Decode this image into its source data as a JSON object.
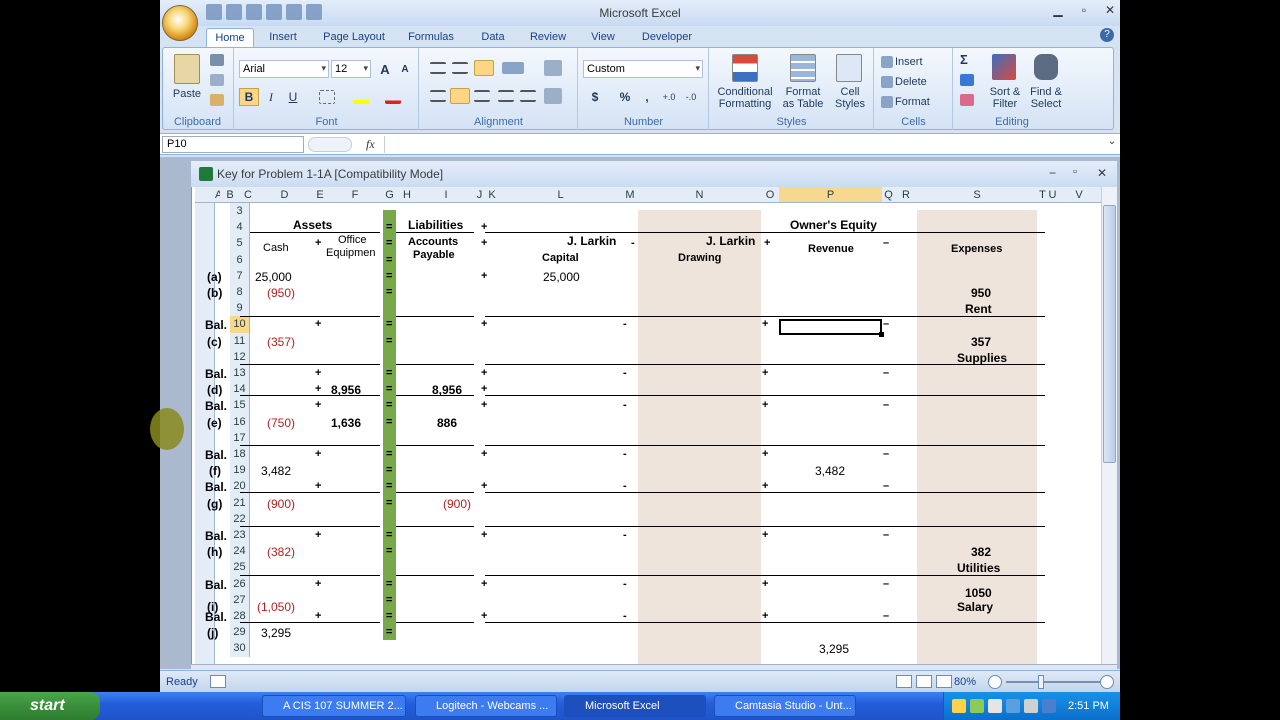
{
  "window": {
    "title": "Microsoft Excel",
    "minimize": "▁",
    "restore": "▫",
    "close": "✕"
  },
  "tabs": [
    "Home",
    "Insert",
    "Page Layout",
    "Formulas",
    "Data",
    "Review",
    "View",
    "Developer"
  ],
  "ribbon": {
    "clipboard": {
      "paste": "Paste",
      "label": "Clipboard"
    },
    "font": {
      "name": "Arial",
      "size": "12",
      "bold": "B",
      "italic": "I",
      "underline": "U",
      "label": "Font",
      "grow": "A",
      "shrink": "A"
    },
    "alignment": {
      "label": "Alignment"
    },
    "number": {
      "format": "Custom",
      "currency": "$",
      "percent": "%",
      "comma": ",",
      "label": "Number",
      "inc_decimal": "+.0",
      "dec_decimal": "-.0"
    },
    "styles": {
      "conditional": "Conditional",
      "conditional2": "Formatting",
      "format_table": "Format",
      "format_table2": "as Table",
      "cell_styles": "Cell",
      "cell_styles2": "Styles",
      "label": "Styles"
    },
    "cells": {
      "insert": "Insert",
      "delete": "Delete",
      "format": "Format",
      "label": "Cells"
    },
    "editing": {
      "sigma": "Σ",
      "sort": "Sort &",
      "sort2": "Filter",
      "find": "Find &",
      "find2": "Select",
      "label": "Editing"
    }
  },
  "formula_bar": {
    "name_box": "P10",
    "fx": "fx",
    "value": ""
  },
  "workbook": {
    "title": "Key for Problem 1-1A  [Compatibility Mode]"
  },
  "columns": [
    "A",
    "B",
    "C",
    "D",
    "E",
    "F",
    "G",
    "H",
    "I",
    "J",
    "K",
    "L",
    "M",
    "N",
    "O",
    "P",
    "Q",
    "R",
    "S",
    "T",
    "U",
    "V"
  ],
  "rows": [
    "3",
    "4",
    "5",
    "6",
    "7",
    "8",
    "9",
    "10",
    "11",
    "12",
    "13",
    "14",
    "15",
    "16",
    "17",
    "18",
    "19",
    "20",
    "21",
    "22",
    "23",
    "24",
    "25",
    "26",
    "27",
    "28",
    "29",
    "30"
  ],
  "sheet": {
    "assets": "Assets",
    "liabilities": "Liabilities",
    "owners_equity": "Owner's Equity",
    "cash": "Cash",
    "office_equipment": "Office",
    "office_equipment2": "Equipmen",
    "accounts_payable": "Accounts",
    "accounts_payable2": "Payable",
    "larkin1": "J. Larkin",
    "capital": "Capital",
    "larkin2": "J. Larkin",
    "drawing": "Drawing",
    "revenue": "Revenue",
    "expenses": "Expenses",
    "plus": "+",
    "minus": "-",
    "endash": "–",
    "equals": "=",
    "r7_label": "(a)",
    "r7_cash": "25,000",
    "r7_capital": "25,000",
    "r8_label": "(b)",
    "r8_cash": "(950)",
    "r8_exp": "950",
    "r9_exp": "Rent",
    "r10_label": "Bal.",
    "r11_label": "(c)",
    "r11_cash": "(357)",
    "r11_exp": "357",
    "r12_exp": "Supplies",
    "r13_label": "Bal.",
    "r14_label": "(d)",
    "r14_equip": "8,956",
    "r14_ap": "8,956",
    "r15_label": "Bal.",
    "r16_label": "(e)",
    "r16_cash": "(750)",
    "r16_equip": "1,636",
    "r16_ap": "886",
    "r18_label": "Bal.",
    "r19_label": "(f)",
    "r19_cash": "3,482",
    "r19_rev": "3,482",
    "r20_label": "Bal.",
    "r21_label": "(g)",
    "r21_cash": "(900)",
    "r21_ap": "(900)",
    "r23_label": "Bal.",
    "r24_label": "(h)",
    "r24_cash": "(382)",
    "r24_exp": "382",
    "r25_exp": "Utilities",
    "r26_label": "Bal.",
    "r27_label": "(i)",
    "r27_cash": "(1,050)",
    "r26_exp": "1050",
    "r27_exp": "Salary",
    "r28_label": "Bal.",
    "r29_label": "(j)",
    "r29_cash": "3,295",
    "r30_rev": "3,295"
  },
  "status": {
    "ready": "Ready",
    "zoom": "80%"
  },
  "taskbar": {
    "start": "start",
    "items": [
      "A CIS 107 SUMMER 2...",
      "Logitech - Webcams ...",
      "Microsoft Excel",
      "Camtasia Studio - Unt..."
    ],
    "clock": "2:51 PM"
  }
}
